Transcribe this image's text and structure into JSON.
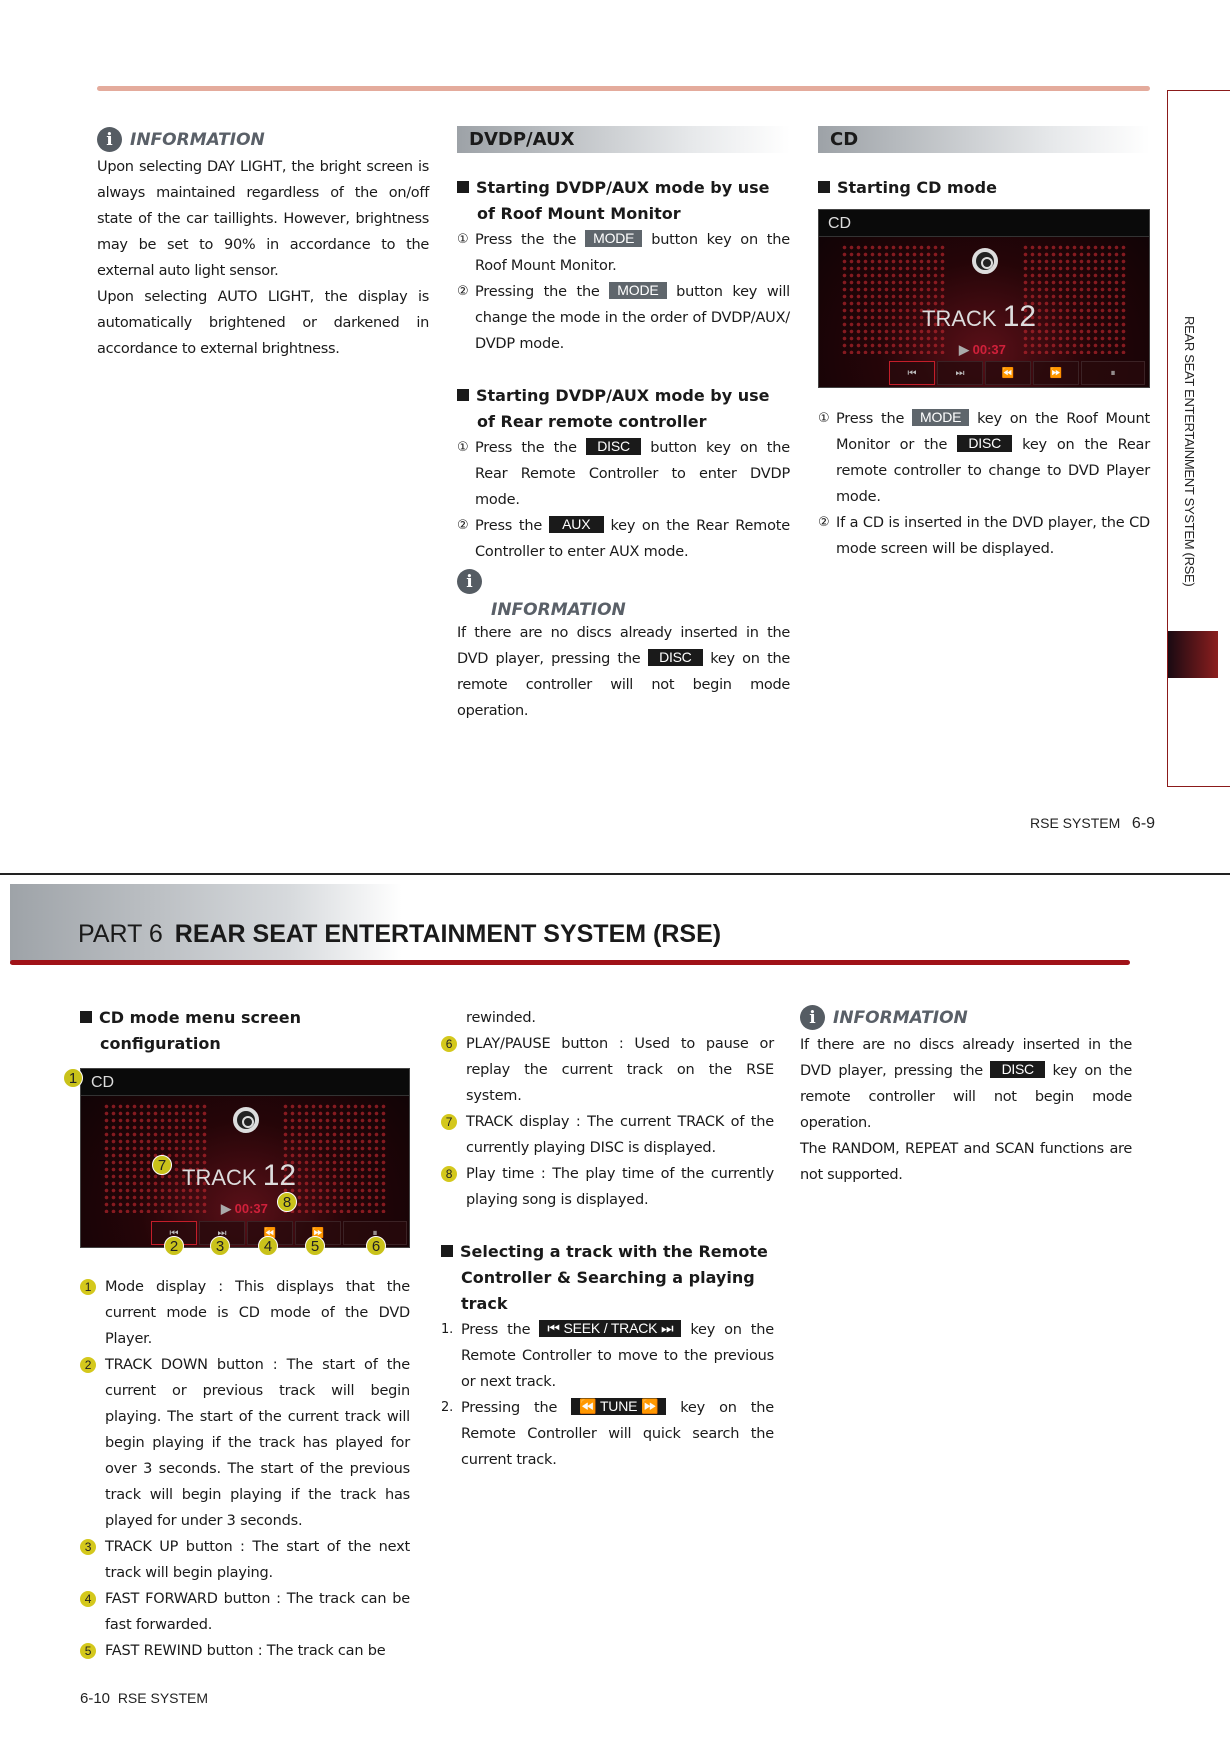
{
  "top_page": {
    "col1": {
      "info_title": "INFORMATION",
      "paragraphs": [
        "Upon selecting DAY LIGHT, the bright screen is always maintained regardless of the on/off state of the car taillights. However, brightness may be set to 90% in accordance to the external auto light sensor.",
        "Upon selecting AUTO LIGHT, the display is automatically brightened or darkened in accordance to external brightness."
      ]
    },
    "col2": {
      "section_title": "DVDP/AUX",
      "heading1": "Starting DVDP/AUX mode by use of Roof Mount Monitor",
      "steps1": [
        {
          "num": "①",
          "pre": "Press the the",
          "key": "MODE",
          "post": "button key on the Roof Mount Monitor."
        },
        {
          "num": "②",
          "pre": "Pressing the the",
          "key": "MODE",
          "post": "button key will change the mode in the order of DVDP/AUX/ DVDP mode."
        }
      ],
      "heading2": "Starting DVDP/AUX mode by use of Rear remote controller",
      "steps2": [
        {
          "num": "①",
          "pre": "Press the the",
          "key": "DISC",
          "post": "button key on the Rear Remote Controller to enter DVDP mode."
        },
        {
          "num": "②",
          "pre": "Press the",
          "key": "AUX",
          "post": "key on the Rear Remote Controller to enter AUX mode."
        }
      ],
      "info_title": "INFORMATION",
      "info_pre": "If there are no discs already inserted in the DVD player, pressing the",
      "info_key": "DISC",
      "info_post": "key on the remote controller will not begin mode operation."
    },
    "col3": {
      "section_title": "CD",
      "heading": "Starting CD mode",
      "screen": {
        "mode": "CD",
        "track_label": "TRACK",
        "track_number": "12",
        "play_time": "00:37",
        "controls": [
          "⏮",
          "⏭",
          "⏪",
          "⏩",
          "⏸"
        ]
      },
      "steps": [
        {
          "num": "①",
          "pre": "Press the",
          "key": "MODE",
          "mid": "key on the Roof Mount Monitor or the",
          "key2": "DISC",
          "post": "key on the Rear remote controller to change to DVD Player mode."
        },
        {
          "num": "②",
          "pre": "If a CD is inserted in the DVD player, the CD mode screen will be displayed."
        }
      ]
    },
    "side_tab_text": "REAR SEAT ENTERTAINMENT SYSTEM (RSE)",
    "footer": {
      "section": "RSE SYSTEM",
      "page": "6-9"
    }
  },
  "bottom_page": {
    "part_label": "PART 6",
    "part_title": "REAR SEAT ENTERTAINMENT SYSTEM (RSE)",
    "col1": {
      "heading": "CD mode menu screen configuration",
      "screen": {
        "mode": "CD",
        "track_label": "TRACK",
        "track_number": "12",
        "play_time": "00:37",
        "controls": [
          "⏮",
          "⏭",
          "⏪",
          "⏩",
          "⏸"
        ],
        "callouts": [
          "1",
          "2",
          "3",
          "4",
          "5",
          "6",
          "7",
          "8"
        ]
      },
      "items": [
        {
          "n": "1",
          "text": "Mode display : This displays that the current mode is CD mode of the DVD Player."
        },
        {
          "n": "2",
          "text": "TRACK DOWN button : The start of the current or previous track will begin playing. The start of the current track will begin playing if the track has played for over 3 seconds. The start of the previous track will begin playing if the track has played for under 3 seconds."
        },
        {
          "n": "3",
          "text": "TRACK UP button : The start of the next track will begin playing."
        },
        {
          "n": "4",
          "text": "FAST FORWARD button : The track can be fast forwarded."
        },
        {
          "n": "5",
          "text": "FAST REWIND button : The track can be"
        }
      ]
    },
    "col2": {
      "continuation": "rewinded.",
      "items": [
        {
          "n": "6",
          "text": "PLAY/PAUSE button : Used to pause or replay the current track on the RSE system."
        },
        {
          "n": "7",
          "text": "TRACK display : The current TRACK of the currently playing DISC is displayed."
        },
        {
          "n": "8",
          "text": "Play time : The play time of the currently playing song is displayed."
        }
      ],
      "heading": "Selecting a track with the Remote Controller & Searching a playing track",
      "steps": [
        {
          "num": "1.",
          "pre": "Press the",
          "key": "⏮ SEEK / TRACK ⏭",
          "post": "key on the Remote Controller to move to the previous or next track."
        },
        {
          "num": "2.",
          "pre": "Pressing the",
          "key": "⏪ TUNE ⏩",
          "post": "key on the Remote Controller will quick search the current track."
        }
      ]
    },
    "col3": {
      "info_title": "INFORMATION",
      "info_pre": "If there are no discs already inserted in the DVD player, pressing the",
      "info_key": "DISC",
      "info_post": "key on the remote controller will not begin mode operation.",
      "note": "The RANDOM, REPEAT and SCAN functions are not supported."
    },
    "footer": {
      "page": "6-10",
      "section": "RSE SYSTEM"
    }
  }
}
